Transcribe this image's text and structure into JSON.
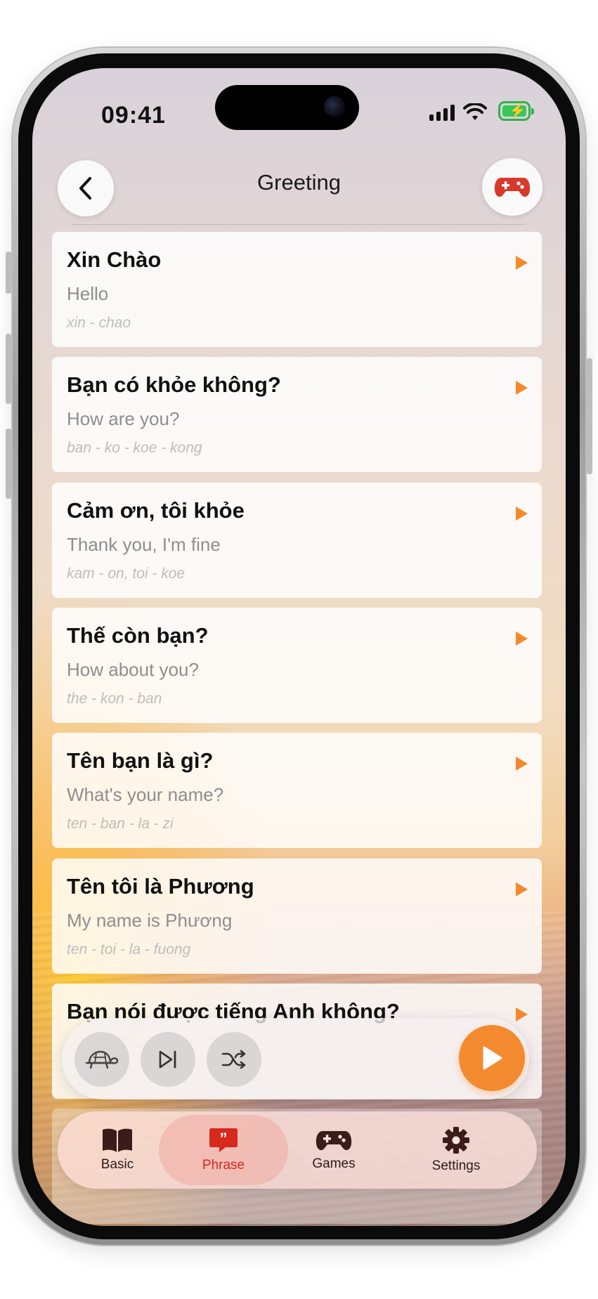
{
  "status_bar": {
    "time": "09:41"
  },
  "header": {
    "title": "Greeting"
  },
  "phrases": [
    {
      "vi": "Xin Chào",
      "en": "Hello",
      "pron": "xin - chao"
    },
    {
      "vi": "Bạn có khỏe không?",
      "en": "How are you?",
      "pron": "ban - ko - koe - kong"
    },
    {
      "vi": "Cảm ơn, tôi khỏe",
      "en": "Thank you, I'm fine",
      "pron": "kam - on, toi - koe"
    },
    {
      "vi": "Thế còn bạn?",
      "en": "How about you?",
      "pron": "the - kon - ban"
    },
    {
      "vi": "Tên bạn là gì?",
      "en": "What's your name?",
      "pron": "ten - ban - la - zi"
    },
    {
      "vi": "Tên tôi là Phương",
      "en": "My name is Phương",
      "pron": "ten - toi - la - fuong"
    },
    {
      "vi": "Bạn nói được tiếng Anh không?",
      "en": "",
      "pron": ""
    }
  ],
  "tabs": [
    {
      "label": "Basic",
      "icon": "book-icon"
    },
    {
      "label": "Phrase",
      "icon": "quote-bubble-icon",
      "active": true
    },
    {
      "label": "Games",
      "icon": "gamepad-icon"
    },
    {
      "label": "Settings",
      "icon": "gear-icon"
    }
  ],
  "colors": {
    "accent": "#f48a2f",
    "active_tab": "#d7281c",
    "game_icon": "#d7392b"
  }
}
